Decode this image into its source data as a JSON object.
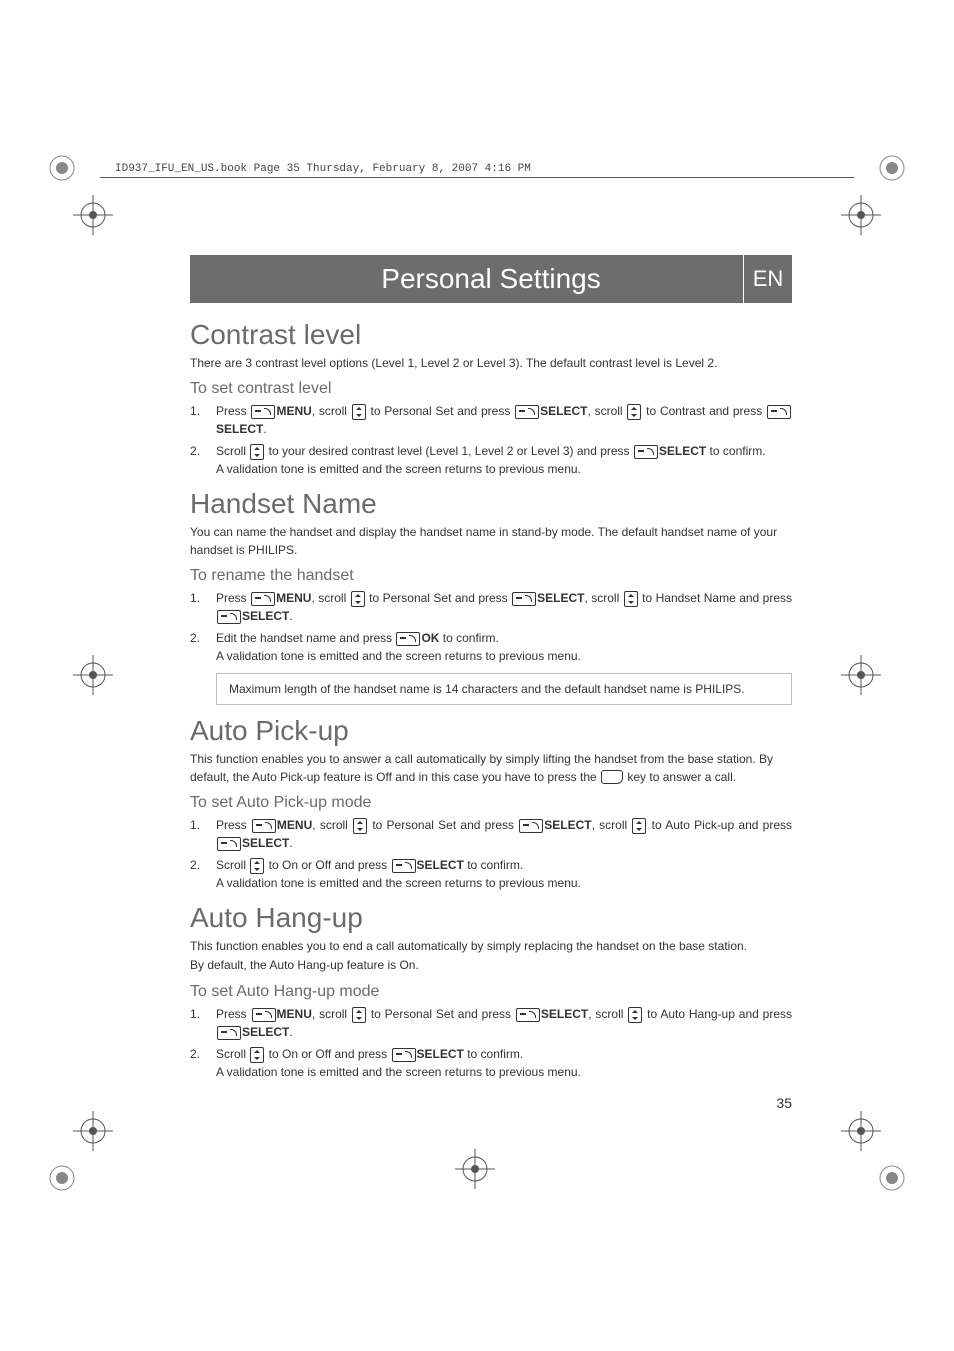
{
  "meta": {
    "book_header": "ID937_IFU_EN_US.book  Page 35  Thursday, February 8, 2007  4:16 PM",
    "page_number": "35"
  },
  "title_bar": {
    "title": "Personal Settings",
    "lang": "EN"
  },
  "sections": {
    "contrast": {
      "heading": "Contrast level",
      "intro": "There are 3 contrast level options (Level 1, Level 2 or Level 3). The default contrast level is Level 2.",
      "sub": "To set contrast level",
      "step1_a": "Press ",
      "step1_menu": "MENU",
      "step1_b": ", scroll ",
      "step1_c": " to Personal Set and press ",
      "step1_select1": "SELECT",
      "step1_d": ", scroll ",
      "step1_e": " to Contrast and press ",
      "step1_select2": "SELECT",
      "step1_f": ".",
      "step2_a": "Scroll ",
      "step2_b": " to your desired contrast level (Level 1, Level 2 or Level 3) and press ",
      "step2_select": "SELECT",
      "step2_c": " to confirm.",
      "step2_note": "A validation tone is emitted and the screen returns to previous menu."
    },
    "handset": {
      "heading": "Handset Name",
      "intro": "You can name the handset and display the handset name in stand-by mode. The default handset name of your handset is PHILIPS.",
      "sub": "To rename the handset",
      "step1_a": "Press ",
      "step1_menu": "MENU",
      "step1_b": ", scroll ",
      "step1_c": " to Personal Set and press ",
      "step1_select1": "SELECT",
      "step1_d": ", scroll ",
      "step1_e": " to Handset Name and press ",
      "step1_select2": "SELECT",
      "step1_f": ".",
      "step2_a": "Edit the handset name and press ",
      "step2_ok": "OK",
      "step2_b": " to confirm.",
      "step2_note": "A validation tone is emitted and the screen returns to previous menu.",
      "note_box": "Maximum length of the handset name is 14 characters and the default handset name is PHILIPS."
    },
    "pickup": {
      "heading": "Auto Pick-up",
      "intro_a": "This function enables you to answer a call automatically by simply lifting the handset from the base station. By default, the Auto Pick-up feature is Off and in this case you have to press the ",
      "intro_b": " key to answer a call.",
      "sub": "To set Auto Pick-up mode",
      "step1_a": "Press ",
      "step1_menu": "MENU",
      "step1_b": ", scroll ",
      "step1_c": " to Personal Set and press ",
      "step1_select1": "SELECT",
      "step1_d": ", scroll ",
      "step1_e": " to Auto Pick-up and press ",
      "step1_select2": "SELECT",
      "step1_f": ".",
      "step2_a": "Scroll ",
      "step2_b": " to On or Off and press ",
      "step2_select": "SELECT",
      "step2_c": " to confirm.",
      "step2_note": "A validation tone is emitted and the screen returns to previous menu."
    },
    "hangup": {
      "heading": "Auto Hang-up",
      "intro1": "This function enables you to end a call automatically by simply replacing the handset on the base station.",
      "intro2": "By default, the Auto Hang-up feature is On.",
      "sub": "To set Auto Hang-up mode",
      "step1_a": "Press ",
      "step1_menu": "MENU",
      "step1_b": ", scroll ",
      "step1_c": " to Personal Set and press ",
      "step1_select1": "SELECT",
      "step1_d": ", scroll ",
      "step1_e": " to Auto Hang-up and press ",
      "step1_select2": "SELECT",
      "step1_f": ".",
      "step2_a": "Scroll ",
      "step2_b": " to On or Off and press ",
      "step2_select": "SELECT",
      "step2_c": " to confirm.",
      "step2_note": "A validation tone is emitted and the screen returns to previous menu."
    }
  }
}
